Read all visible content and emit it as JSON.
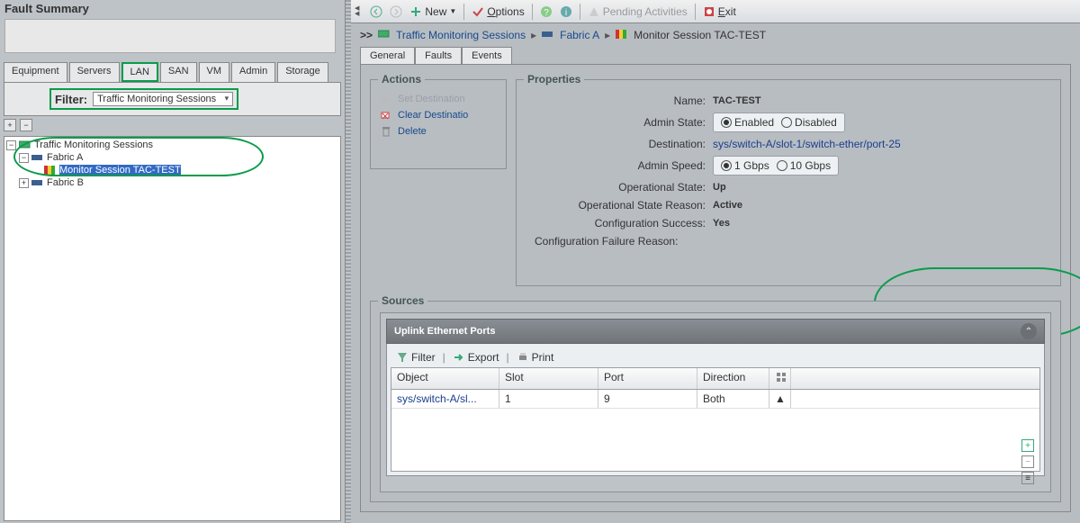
{
  "fault_summary_title": "Fault Summary",
  "nav_tabs": {
    "equipment": "Equipment",
    "servers": "Servers",
    "lan": "LAN",
    "san": "SAN",
    "vm": "VM",
    "admin": "Admin",
    "storage": "Storage"
  },
  "filter": {
    "label": "Filter:",
    "value": "Traffic Monitoring Sessions"
  },
  "tree": {
    "root": "Traffic Monitoring Sessions",
    "fabric_a": "Fabric A",
    "session": "Monitor Session TAC-TEST",
    "fabric_b": "Fabric B"
  },
  "toolbar": {
    "new": "New",
    "options": "Options",
    "pending": "Pending Activities",
    "exit": "Exit"
  },
  "breadcrumb": {
    "gt": ">>",
    "lvl1": "Traffic Monitoring Sessions",
    "lvl2": "Fabric A",
    "lvl3": "Monitor Session TAC-TEST"
  },
  "detail_tabs": {
    "general": "General",
    "faults": "Faults",
    "events": "Events"
  },
  "actions": {
    "legend": "Actions",
    "set_dest": "Set Destination",
    "clear_dest": "Clear Destinatio",
    "delete": "Delete"
  },
  "properties": {
    "legend": "Properties",
    "name_label": "Name:",
    "name_val": "TAC-TEST",
    "admin_state_label": "Admin State:",
    "enabled": "Enabled",
    "disabled": "Disabled",
    "destination_label": "Destination:",
    "destination_val": "sys/switch-A/slot-1/switch-ether/port-25",
    "admin_speed_label": "Admin Speed:",
    "speed1": "1 Gbps",
    "speed10": "10 Gbps",
    "op_state_label": "Operational State:",
    "op_state_val": "Up",
    "op_reason_label": "Operational State Reason:",
    "op_reason_val": "Active",
    "cfg_success_label": "Configuration Success:",
    "cfg_success_val": "Yes",
    "cfg_fail_label": "Configuration Failure Reason:"
  },
  "sources": {
    "legend": "Sources",
    "panel_title": "Uplink Ethernet Ports",
    "filter": "Filter",
    "export": "Export",
    "print": "Print",
    "cols": {
      "object": "Object",
      "slot": "Slot",
      "port": "Port",
      "direction": "Direction"
    },
    "row": {
      "object": "sys/switch-A/sl...",
      "slot": "1",
      "port": "9",
      "direction": "Both"
    }
  }
}
